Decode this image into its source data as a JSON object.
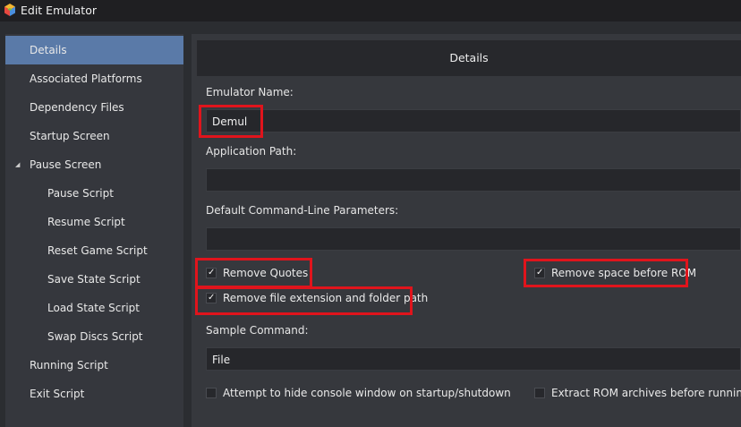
{
  "window": {
    "title": "Edit Emulator"
  },
  "sidebar": {
    "items": [
      {
        "label": "Details"
      },
      {
        "label": "Associated Platforms"
      },
      {
        "label": "Dependency Files"
      },
      {
        "label": "Startup Screen"
      },
      {
        "label": "Pause Screen"
      },
      {
        "label": "Pause Script"
      },
      {
        "label": "Resume Script"
      },
      {
        "label": "Reset Game Script"
      },
      {
        "label": "Save State Script"
      },
      {
        "label": "Load State Script"
      },
      {
        "label": "Swap Discs Script"
      },
      {
        "label": "Running Script"
      },
      {
        "label": "Exit Script"
      }
    ],
    "expander_glyph": "◢"
  },
  "details": {
    "header": "Details",
    "emulator_name_label": "Emulator Name:",
    "emulator_name_value": "Demul",
    "application_path_label": "Application Path:",
    "application_path_value": "",
    "command_line_label": "Default Command-Line Parameters:",
    "command_line_value": "",
    "remove_quotes": {
      "label": "Remove Quotes",
      "checked": true
    },
    "remove_space": {
      "label": "Remove space before ROM",
      "checked": true
    },
    "remove_extension": {
      "label": "Remove file extension and folder path",
      "checked": true
    },
    "sample_command_label": "Sample Command:",
    "sample_command_value": "File",
    "hide_console": {
      "label": "Attempt to hide console window on startup/shutdown",
      "checked": false
    },
    "extract_rom": {
      "label": "Extract ROM archives before running",
      "checked": false
    }
  },
  "colors": {
    "highlight": "#e0141c",
    "active_item": "#5a7aa8",
    "background": "#2b2d31"
  }
}
